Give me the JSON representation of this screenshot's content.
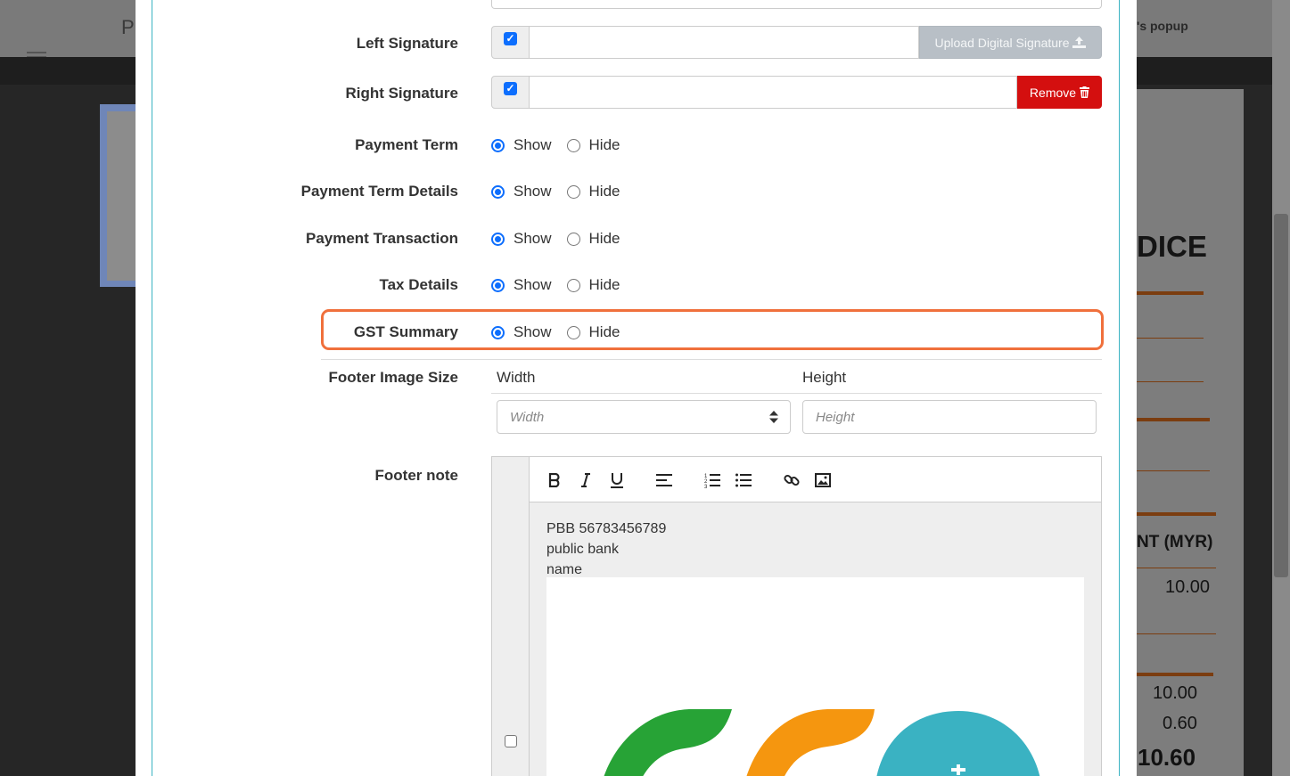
{
  "background": {
    "title_letter": "P",
    "popup_text": "'s popup",
    "doc_title": "DICE",
    "amount_header": "NT (MYR)",
    "line_value": "10.00",
    "subtotal": "10.00",
    "tax": "0.60",
    "total": "10.60"
  },
  "form": {
    "left_signature": {
      "label": "Left Signature",
      "checked": true,
      "button": "Upload Digital Signature"
    },
    "right_signature": {
      "label": "Right Signature",
      "checked": true,
      "button": "Remove"
    },
    "radio_rows": [
      {
        "label": "Payment Term",
        "show": "Show",
        "hide": "Hide",
        "selected": "show"
      },
      {
        "label": "Payment Term Details",
        "show": "Show",
        "hide": "Hide",
        "selected": "show"
      },
      {
        "label": "Payment Transaction",
        "show": "Show",
        "hide": "Hide",
        "selected": "show"
      },
      {
        "label": "Tax Details",
        "show": "Show",
        "hide": "Hide",
        "selected": "show"
      },
      {
        "label": "GST Summary",
        "show": "Show",
        "hide": "Hide",
        "selected": "show",
        "highlighted": true
      }
    ],
    "footer_image_size": {
      "label": "Footer Image Size",
      "width_header": "Width",
      "height_header": "Height",
      "width_placeholder": "Width",
      "height_placeholder": "Height"
    },
    "footer_note": {
      "label": "Footer note",
      "lines": [
        "PBB 56783456789",
        "public bank",
        "name"
      ],
      "toolbar": [
        "bold-icon",
        "italic-icon",
        "underline-icon",
        "align-left-icon",
        "ordered-list-icon",
        "unordered-list-icon",
        "link-icon",
        "image-icon"
      ]
    }
  },
  "colors": {
    "accent": "#0d6efd",
    "highlight": "#f0703c",
    "danger": "#d40f0f",
    "modal_border": "#3bb3c3",
    "logo_green": "#27a336",
    "logo_orange": "#f5960f",
    "logo_teal": "#3ab2c2"
  }
}
